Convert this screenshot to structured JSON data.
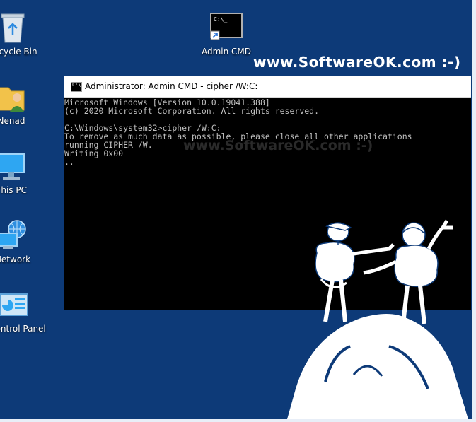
{
  "desktop": {
    "icons": [
      {
        "label": "Recycle Bin",
        "icon": "recycle-bin-icon"
      },
      {
        "label": "Nenad",
        "icon": "user-folder-icon"
      },
      {
        "label": "This PC",
        "icon": "computer-icon"
      },
      {
        "label": "Network",
        "icon": "network-icon"
      },
      {
        "label": "Control Panel",
        "icon": "control-panel-icon"
      },
      {
        "label": "Admin CMD",
        "icon": "cmd-shortcut-icon"
      }
    ],
    "watermark": "www.SoftwareOK.com :-)"
  },
  "cmd_window": {
    "title": "Administrator: Admin CMD - cipher  /W:C:",
    "icon_text": "C:\\",
    "lines": [
      "Microsoft Windows [Version 10.0.19041.388]",
      "(c) 2020 Microsoft Corporation. All rights reserved.",
      "",
      "C:\\Windows\\system32>cipher /W:C:",
      "To remove as much data as possible, please close all other applications",
      "running CIPHER /W.",
      "Writing 0x00",
      ".."
    ],
    "watermark": "www.SoftwareOK.com :-)"
  },
  "colors": {
    "desktop_background": "#0d3a78",
    "console_background": "#000000",
    "console_text": "#c0c0c0"
  }
}
